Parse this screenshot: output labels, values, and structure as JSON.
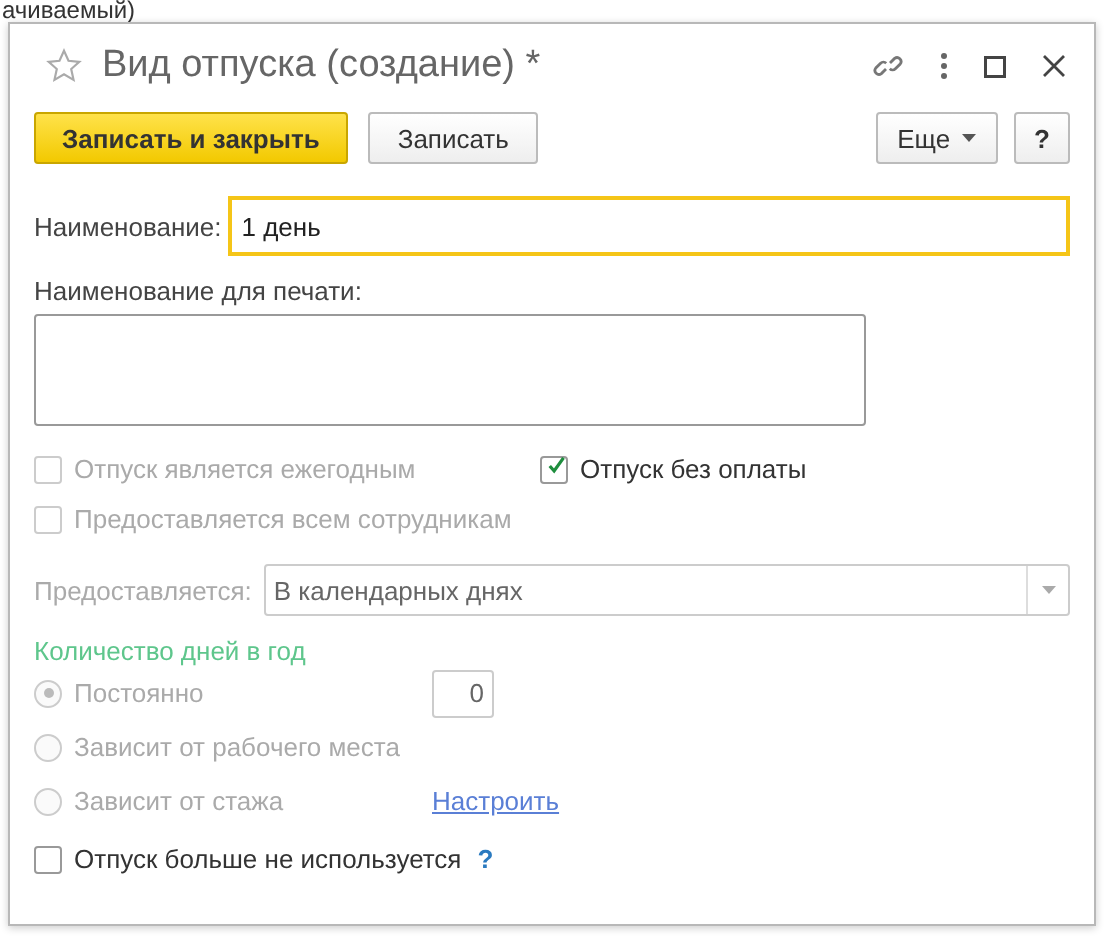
{
  "background": {
    "texts": [
      "ачиваемый)"
    ]
  },
  "window": {
    "title": "Вид отпуска (создание) *",
    "favorite": false
  },
  "toolbar": {
    "buttons": [
      {
        "label": "Записать и закрыть",
        "kind": "primary"
      },
      {
        "label": "Записать",
        "kind": "normal"
      }
    ],
    "more": "Еще",
    "help": "?"
  },
  "name_field": {
    "label": "Наименование:",
    "value": "1 день",
    "focused": true
  },
  "print_name": {
    "label": "Наименование для печати:"
  },
  "checkboxes": [
    {
      "label": "Отпуск является ежегодным",
      "checked": false,
      "disabled": true
    },
    {
      "label": "Отпуск без оплаты",
      "checked": true,
      "disabled": false
    },
    {
      "label": "Предоставляется всем сотрудникам",
      "checked": false,
      "disabled": true
    }
  ],
  "provided": {
    "label": "Предоставляется:",
    "value": "В календарных днях",
    "disabled": true
  },
  "days_section": {
    "title": "Количество дней в год",
    "options": [
      {
        "label": "Постоянно",
        "selected": true,
        "disabled": true,
        "days": "0"
      },
      {
        "label": "Зависит от рабочего места",
        "selected": false,
        "disabled": true
      },
      {
        "label": "Зависит от стажа",
        "selected": false,
        "disabled": true,
        "link": "Настроить"
      }
    ]
  },
  "not_used": {
    "label": "Отпуск больше не используется",
    "checked": false,
    "help": "?"
  }
}
